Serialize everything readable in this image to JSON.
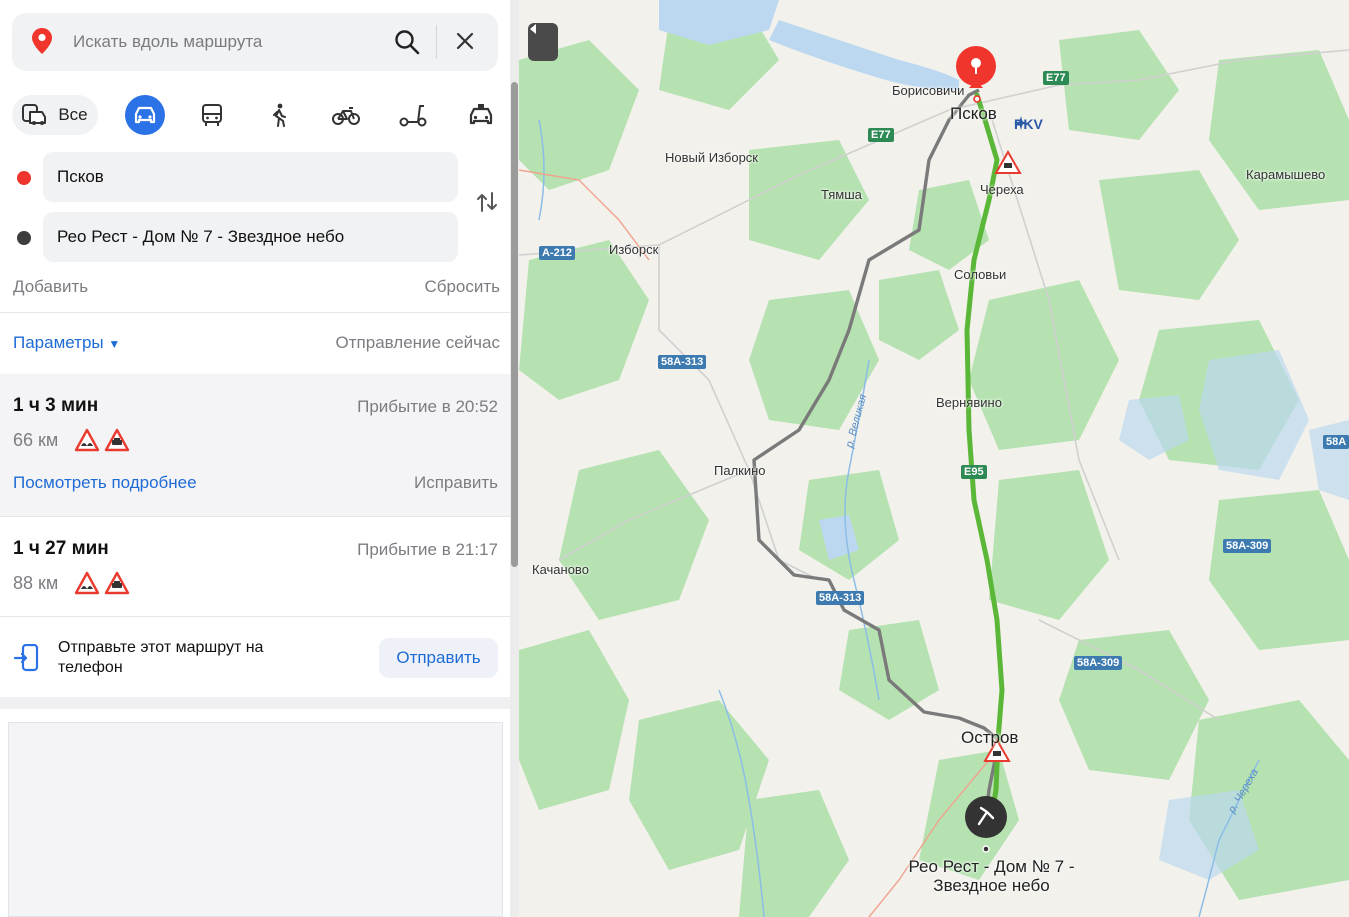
{
  "search": {
    "placeholder": "Искать вдоль маршрута"
  },
  "modes": {
    "all_label": "Все"
  },
  "route_points": {
    "from": "Псков",
    "to": "Рео Рест - Дом № 7 - Звездное небо"
  },
  "actions": {
    "add": "Добавить",
    "reset": "Сбросить"
  },
  "params": {
    "label": "Параметры",
    "departure": "Отправление сейчас"
  },
  "routes": [
    {
      "duration": "1 ч 3 мин",
      "arrival": "Прибытие в 20:52",
      "distance": "66 км",
      "details": "Посмотреть подробнее",
      "fix": "Исправить"
    },
    {
      "duration": "1 ч 27 мин",
      "arrival": "Прибытие в 21:17",
      "distance": "88 км"
    }
  ],
  "send": {
    "text": "Отправьте этот маршрут на телефон",
    "button": "Отправить"
  },
  "map": {
    "places": {
      "borisovichi": "Борисовичи",
      "pskov": "Псков",
      "novy_izborsk": "Новый Изборск",
      "tyamsha": "Тямша",
      "chereha": "Череха",
      "karamyshevo": "Карамышево",
      "izborsk": "Изборск",
      "solovyi": "Соловьи",
      "vernyavino": "Вернявино",
      "palkino": "Палкино",
      "kachanovo": "Качаново",
      "ostrov": "Остров",
      "destination": "Рео Рест - Дом № 7 - Звездное небо"
    },
    "airport": "PKV",
    "roads": {
      "e77": "E77",
      "a212": "А-212",
      "r58_313": "58А-313",
      "e95": "E95",
      "r58_309": "58А-309",
      "r58a": "58А"
    },
    "rivers": {
      "velikaya": "р. Великая",
      "chereha": "р. Череха"
    },
    "colors": {
      "route_main": "#5ab738",
      "route_alt": "#7a7a7a",
      "water": "#bcd8f0",
      "forest": "#b5e2b0"
    }
  }
}
